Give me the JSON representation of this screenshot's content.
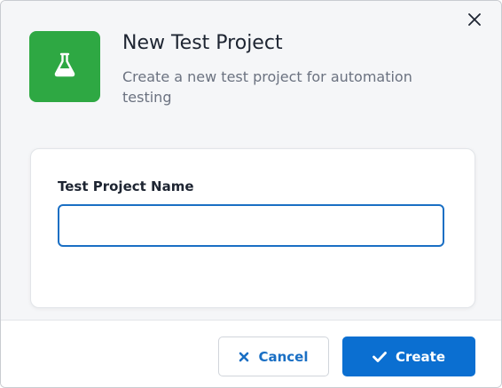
{
  "dialog": {
    "title": "New Test Project",
    "subtitle": "Create a new test project for automation testing",
    "icon": "flask-icon",
    "accent_color": "#2ea843"
  },
  "form": {
    "project_name_label": "Test Project Name",
    "project_name_value": "",
    "project_name_placeholder": ""
  },
  "footer": {
    "cancel_label": "Cancel",
    "create_label": "Create",
    "primary_color": "#0b6fd1"
  }
}
